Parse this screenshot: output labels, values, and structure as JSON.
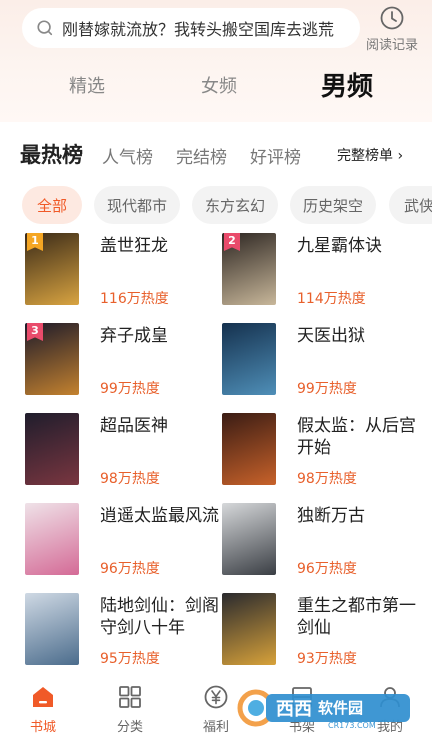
{
  "search": {
    "placeholder": "刚替嫁就流放？我转头搬空国库去逃荒",
    "history_label": "阅读记录"
  },
  "channel_tabs": [
    "精选",
    "女频",
    "男频"
  ],
  "active_channel": "男频",
  "ranking": {
    "title": "最热榜",
    "tabs": [
      "人气榜",
      "完结榜",
      "好评榜"
    ],
    "full_list_label": "完整榜单 ›"
  },
  "categories": [
    "全部",
    "现代都市",
    "东方玄幻",
    "历史架空",
    "武侠"
  ],
  "active_category": "全部",
  "books": [
    {
      "title": "盖世狂龙",
      "heat": "116万热度",
      "rank": "1",
      "badge_color": "#f5a623",
      "cover_colors": [
        "#3a2a18",
        "#d9a441"
      ]
    },
    {
      "title": "九星霸体诀",
      "heat": "114万热度",
      "rank": "2",
      "badge_color": "#e94b6b",
      "cover_colors": [
        "#2d2622",
        "#c8b79a"
      ]
    },
    {
      "title": "弃子成皇",
      "heat": "99万热度",
      "rank": "3",
      "badge_color": "#e94b6b",
      "cover_colors": [
        "#1d1a2a",
        "#c4822f"
      ]
    },
    {
      "title": "天医出狱",
      "heat": "99万热度",
      "rank": "",
      "badge_color": "",
      "cover_colors": [
        "#15314e",
        "#4f8fb8"
      ]
    },
    {
      "title": "超品医神",
      "heat": "98万热度",
      "rank": "",
      "badge_color": "",
      "cover_colors": [
        "#1f1d2c",
        "#7a3640"
      ]
    },
    {
      "title": "假太监：从后宫开始",
      "heat": "98万热度",
      "rank": "",
      "badge_color": "",
      "cover_colors": [
        "#3a1c14",
        "#c8622a"
      ]
    },
    {
      "title": "逍遥太监最风流",
      "heat": "96万热度",
      "rank": "",
      "badge_color": "",
      "cover_colors": [
        "#efe2e8",
        "#d46a96"
      ]
    },
    {
      "title": "独断万古",
      "heat": "96万热度",
      "rank": "",
      "badge_color": "",
      "cover_colors": [
        "#d6d8da",
        "#3a3e44"
      ]
    },
    {
      "title": "陆地剑仙：剑阁守剑八十年",
      "heat": "95万热度",
      "rank": "",
      "badge_color": "",
      "cover_colors": [
        "#cfd9e4",
        "#4b6c8c"
      ]
    },
    {
      "title": "重生之都市第一剑仙",
      "heat": "93万热度",
      "rank": "",
      "badge_color": "",
      "cover_colors": [
        "#2a2a2e",
        "#d8a23a"
      ]
    }
  ],
  "bottom_nav": [
    {
      "label": "书城",
      "icon": "home-icon"
    },
    {
      "label": "分类",
      "icon": "grid-icon"
    },
    {
      "label": "福利",
      "icon": "yen-icon"
    },
    {
      "label": "书架",
      "icon": "bookshelf-icon"
    },
    {
      "label": "我的",
      "icon": "user-icon"
    }
  ],
  "active_nav": "书城",
  "watermark": {
    "text": "西西软件园",
    "sub": "CR173.COM"
  },
  "colors": {
    "accent": "#f05a28",
    "heat": "#e8602c"
  }
}
